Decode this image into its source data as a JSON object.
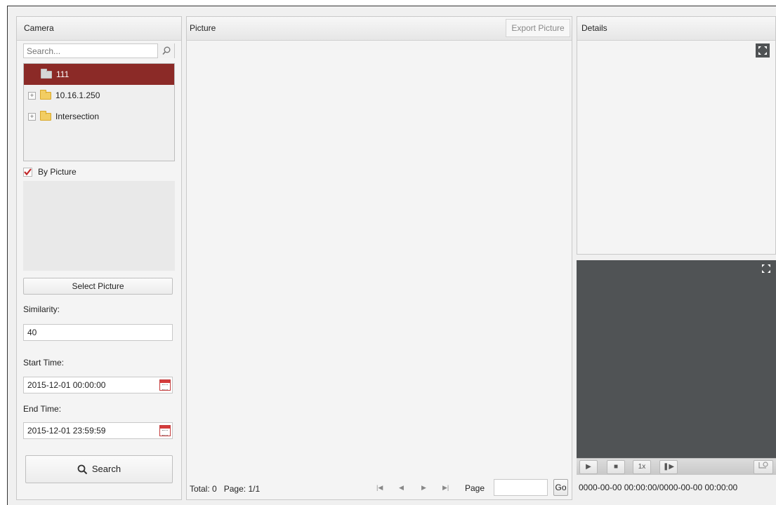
{
  "camera_panel": {
    "title": "Camera",
    "search_placeholder": "Search...",
    "tree": [
      {
        "label": "111",
        "selected": true,
        "icon": "folder-grey-icon"
      },
      {
        "label": "10.16.1.250",
        "selected": false,
        "icon": "folder-yellow-icon"
      },
      {
        "label": "Intersection",
        "selected": false,
        "icon": "folder-yellow-icon"
      }
    ],
    "by_picture_label": "By Picture",
    "by_picture_checked": true,
    "select_picture_label": "Select Picture",
    "similarity_label": "Similarity:",
    "similarity_value": "40",
    "start_time_label": "Start Time:",
    "start_time_value": "2015-12-01 00:00:00",
    "end_time_label": "End Time:",
    "end_time_value": "2015-12-01 23:59:59",
    "search_button_label": "Search"
  },
  "picture_panel": {
    "title": "Picture",
    "export_label": "Export Picture",
    "pager": {
      "total_label": "Total:",
      "total_value": "0",
      "page_label": "Page:",
      "page_value": "1/1",
      "page_input_label": "Page",
      "page_input_value": "",
      "go_label": "Go"
    }
  },
  "details_panel": {
    "title": "Details"
  },
  "player": {
    "speed_label": "1x",
    "time_text": "0000-00-00 00:00:00/0000-00-00 00:00:00"
  },
  "colors": {
    "selected_row": "#8b2a27",
    "video_bg": "#505355",
    "checkbox_check": "#c0282a"
  }
}
